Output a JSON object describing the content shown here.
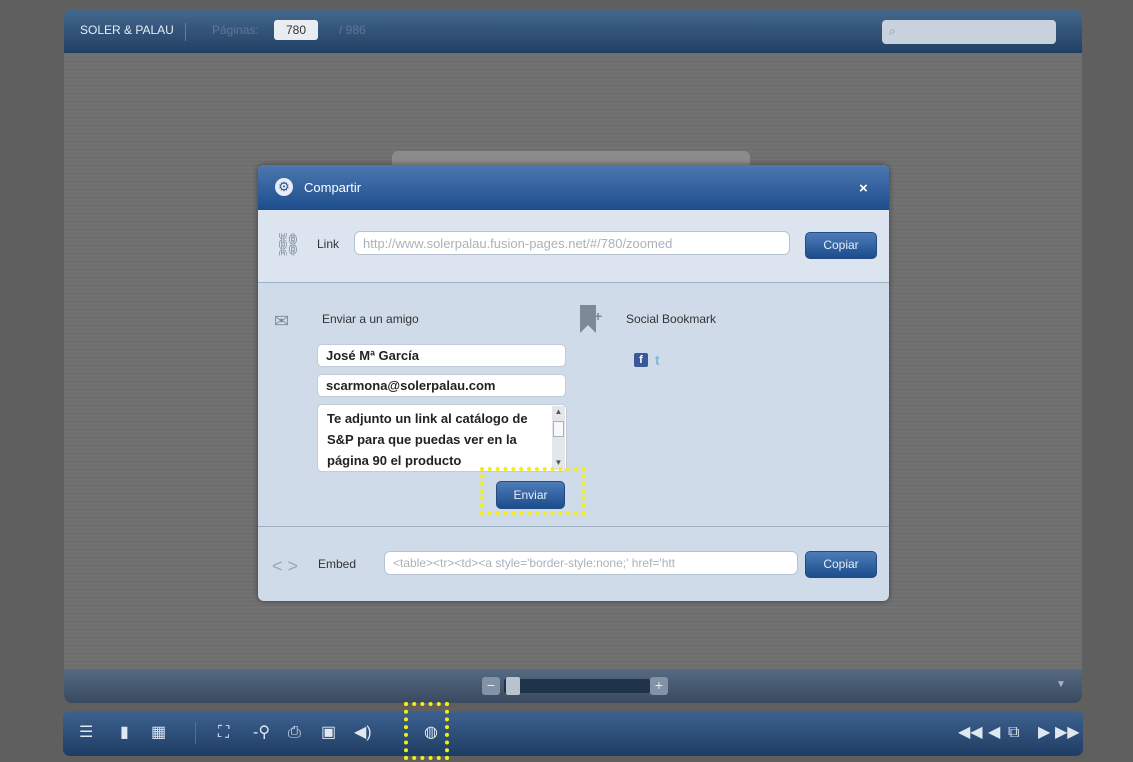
{
  "header": {
    "brand": "SOLER & PALAU",
    "pages_label": "Páginas:",
    "current_page": "780",
    "total_pages": "/ 986",
    "search_placeholder": ""
  },
  "toolbar": {
    "left_icons": [
      "table-of-contents-icon",
      "single-page-icon",
      "thumbnails-grid-icon",
      "fullscreen-icon",
      "zoom-out-icon",
      "print-icon",
      "save-icon",
      "sound-icon",
      "share-icon"
    ],
    "right_icons": [
      "first-page-icon",
      "previous-page-icon",
      "page-view-icon",
      "next-page-icon",
      "last-page-icon"
    ],
    "share_highlighted": true
  },
  "zoom": {
    "minus": "−",
    "plus": "+"
  },
  "share_dialog": {
    "title": "Compartir",
    "close": "×",
    "link": {
      "label": "Link",
      "value": "http://www.solerpalau.fusion-pages.net/#/780/zoomed",
      "copy_label": "Copiar"
    },
    "send_to_friend": {
      "title": "Enviar a un amigo",
      "name_value": "José Mª García",
      "email_value": "scarmona@solerpalau.com",
      "message_value": "Te adjunto un link al catálogo de S&P para que puedas ver en la página 90 el producto",
      "send_label": "Enviar",
      "send_highlighted": true
    },
    "social_bookmark": {
      "title": "Social Bookmark",
      "networks": [
        "facebook",
        "twitter"
      ],
      "facebook_glyph": "f",
      "twitter_glyph": "t"
    },
    "embed": {
      "label": "Embed",
      "value": "<table><tr><td><a style='border-style:none;' href='htt",
      "copy_label": "Copiar"
    }
  },
  "colors": {
    "bar_blue": "#1f3d63",
    "button_blue": "#2c5c9b",
    "dialog_bg": "#cfdbe8",
    "highlight": "#f4ee13"
  }
}
